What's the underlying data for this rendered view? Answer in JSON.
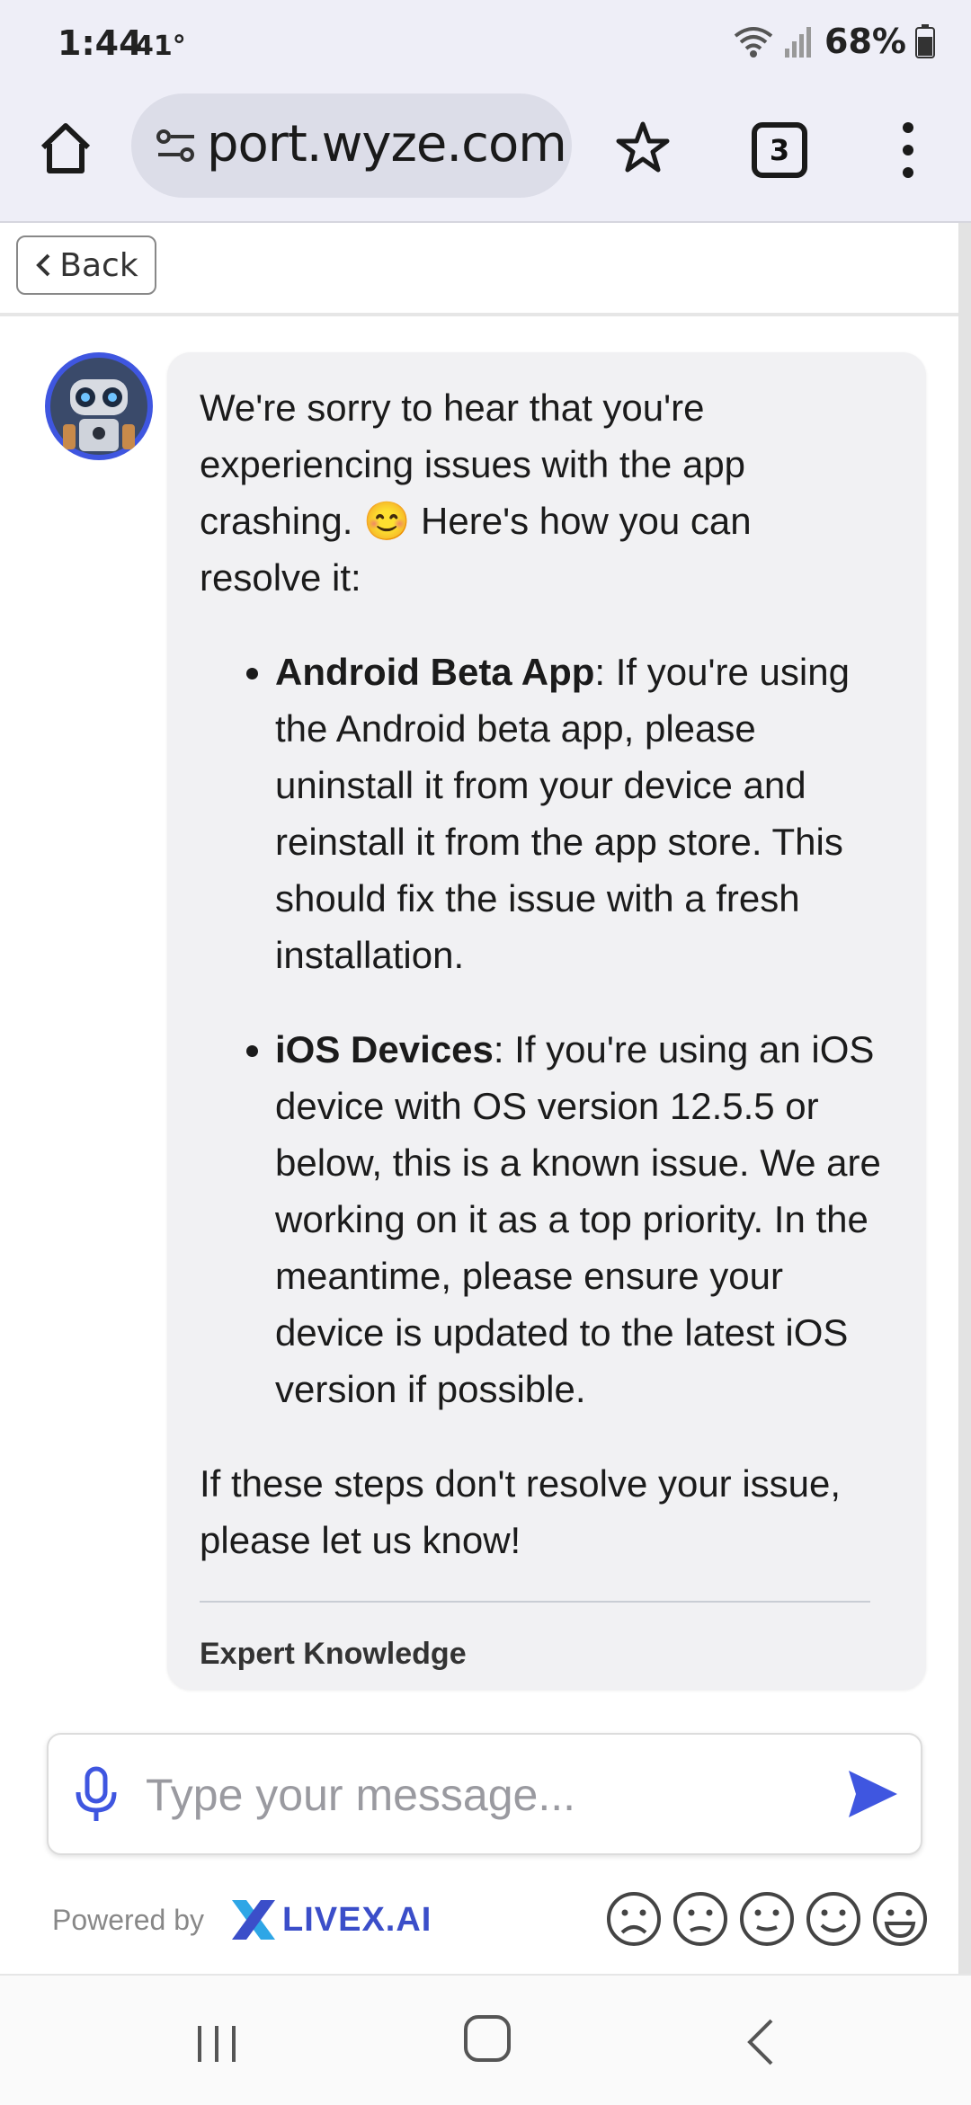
{
  "status_bar": {
    "time": "1:44",
    "temperature": "41°",
    "battery": "68%",
    "icons": [
      "wifi-icon",
      "signal-icon",
      "battery-icon"
    ]
  },
  "browser": {
    "url_display": "port.wyze.com",
    "tab_count": "3",
    "icons": [
      "home-icon",
      "site-info-icon",
      "bookmark-star-icon",
      "tabs-icon",
      "more-menu-icon"
    ]
  },
  "chat": {
    "back_label": "Back",
    "message": {
      "intro": "We're sorry to hear that you're experiencing issues with the app crashing. 😊 Here's how you can resolve it:",
      "items": [
        {
          "title": "Android Beta App",
          "text": ": If you're using the Android beta app, please uninstall it from your device and reinstall it from the app store. This should fix the issue with a fresh installation."
        },
        {
          "title": "iOS Devices",
          "text": ": If you're using an iOS device with OS version 12.5.5 or below, this is a known issue. We are working on it as a top priority. In the meantime, please ensure your device is updated to the latest iOS version if possible."
        }
      ],
      "closing": "If these steps don't resolve your issue, please let us know!",
      "footer_label": "Expert Knowledge"
    },
    "input": {
      "placeholder": "Type your message...",
      "value": ""
    },
    "powered_by": "Powered by",
    "brand": "LIVEX.AI",
    "rating_faces": [
      "very-sad",
      "sad",
      "neutral",
      "happy",
      "very-happy"
    ]
  },
  "colors": {
    "accent": "#3f56e0",
    "chrome_bg": "#eeeef7",
    "bubble_bg": "#f1f1f3"
  }
}
